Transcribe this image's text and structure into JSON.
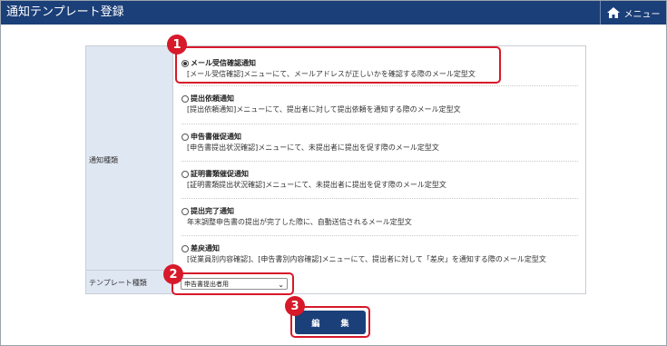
{
  "header": {
    "title": "通知テンプレート登録",
    "menu_label": "メニュー",
    "menu_icon": "home-icon",
    "bg_color": "#1b3f78"
  },
  "form": {
    "notification_type_label": "通知種類",
    "template_type_label": "テンプレート種類",
    "options": [
      {
        "name": "メール受信確認通知",
        "desc": "[メール受信確認]メニューにて、メールアドレスが正しいかを確認する際のメール定型文",
        "checked": true
      },
      {
        "name": "提出依頼通知",
        "desc": "[提出依頼通知]メニューにて、提出者に対して提出依頼を通知する際のメール定型文",
        "checked": false
      },
      {
        "name": "申告書催促通知",
        "desc": "[申告書提出状況確認]メニューにて、未提出者に提出を促す際のメール定型文",
        "checked": false
      },
      {
        "name": "証明書類催促通知",
        "desc": "[証明書類提出状況確認]メニューにて、未提出者に提出を促す際のメール定型文",
        "checked": false
      },
      {
        "name": "提出完了通知",
        "desc": "年末調整申告書の提出が完了した際に、自動送信されるメール定型文",
        "checked": false
      },
      {
        "name": "差戻通知",
        "desc": "[従業員別内容確認]、[申告書別内容確認]メニューにて、提出者に対して「差戻」を通知する際のメール定型文",
        "checked": false
      }
    ],
    "template_select_value": "申告書提出者用",
    "edit_button_label": "編 集"
  },
  "callouts": [
    "1",
    "2",
    "3"
  ],
  "highlight_color": "#d7192a"
}
